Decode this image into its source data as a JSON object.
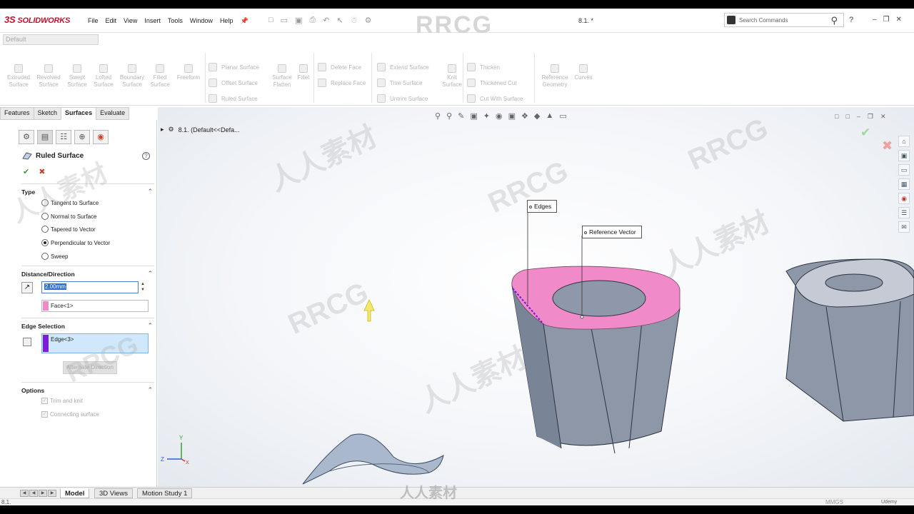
{
  "app": {
    "brand": "SOLIDWORKS",
    "brand_prefix": "3S",
    "menus": [
      "File",
      "Edit",
      "View",
      "Insert",
      "Tools",
      "Window",
      "Help"
    ],
    "doc_name": "8.1. *",
    "search_placeholder": "Search Commands",
    "help_label": "?",
    "watermark": "RRCG"
  },
  "config": {
    "selected": "Default"
  },
  "commands": {
    "big": [
      "Extruded Surface",
      "Revolved Surface",
      "Swept Surface",
      "Lofted Surface",
      "Boundary Surface",
      "Filled Surface",
      "Freeform"
    ],
    "col1": [
      "Planar Surface",
      "Offset Surface",
      "Ruled Surface"
    ],
    "flatten": "Surface Flatten",
    "fillet": "Fillet",
    "col2": [
      "Delete Face",
      "Replace Face"
    ],
    "col3": [
      "Extend Surface",
      "Trim Surface",
      "Untrim Surface"
    ],
    "knit": "Knit Surface",
    "col4": [
      "Thicken",
      "Thickened Cut",
      "Cut With Surface"
    ],
    "ref": "Reference Geometry",
    "curves": "Curves"
  },
  "tabs": [
    "Features",
    "Sketch",
    "Surfaces",
    "Evaluate"
  ],
  "active_tab": "Surfaces",
  "feature": {
    "title": "Ruled Surface",
    "type_header": "Type",
    "type_options": [
      "Tangent to Surface",
      "Normal to Surface",
      "Tapered to Vector",
      "Perpendicular to Vector",
      "Sweep"
    ],
    "type_selected": "Perpendicular to Vector",
    "distance_header": "Distance/Direction",
    "distance_value": "2.00mm",
    "direction_ref": "Face<1>",
    "edge_header": "Edge Selection",
    "edge_value": "Edge<3>",
    "alternate_label": "Alternate Direction",
    "options_header": "Options",
    "options": [
      {
        "label": "Trim and knit",
        "checked": true
      },
      {
        "label": "Connecting surface",
        "checked": true
      }
    ],
    "colors": {
      "face": "#f08ac8",
      "edge": "#7a1fd4"
    }
  },
  "viewport": {
    "tree_label": "8.1.  (Default<<Defa...",
    "callouts": {
      "edges": "Edges",
      "reference_vector": "Reference Vector"
    },
    "triad": {
      "x": "X",
      "y": "Y",
      "z": "Z"
    }
  },
  "bottom_tabs": [
    "Model",
    "3D Views",
    "Motion Study 1"
  ],
  "active_bottom_tab": "Model",
  "status": {
    "left": "8.1.",
    "units": "MMGS"
  },
  "footer": {
    "logo": "人人素材",
    "udemy": "Udemy"
  }
}
